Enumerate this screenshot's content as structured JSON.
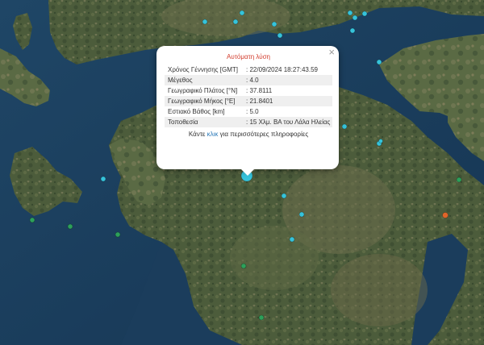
{
  "popup": {
    "title": "Αυτόματη λύση",
    "close_symbol": "×",
    "rows": [
      {
        "label": "Χρόνος Γέννησης [GMT]",
        "value": ": 22/09/2024 18:27:43.59"
      },
      {
        "label": "Μέγεθος",
        "value": ": 4.0"
      },
      {
        "label": "Γεωγραφικό Πλάτος [°N]",
        "value": ": 37.8111"
      },
      {
        "label": "Γεωγραφικό Μήκος [°E]",
        "value": ": 21.8401"
      },
      {
        "label": "Εστιακό Βάθος [km]",
        "value": ": 5.0"
      },
      {
        "label": "Τοποθεσία",
        "value": ": 15 Χλμ. ΒΑ του Λάλα Ηλείας"
      }
    ],
    "more_prefix": "Κάντε ",
    "more_link": "κλικ",
    "more_suffix": " για περισσότερες πληροφορίες"
  },
  "colors": {
    "sea": "#1c3f5f",
    "land": "#4a5a3a",
    "marker_cyan": "#36c3da",
    "marker_green": "#2da05a",
    "marker_orange": "#e0652a",
    "title_red": "#d23b2b",
    "link_blue": "#2a7ab9"
  }
}
